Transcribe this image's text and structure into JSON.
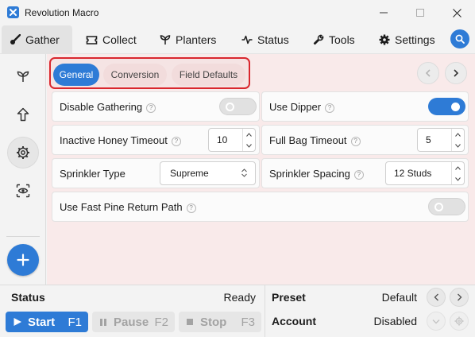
{
  "window": {
    "title": "Revolution Macro"
  },
  "tabs": [
    {
      "label": "Gather",
      "icon": "brush-icon"
    },
    {
      "label": "Collect",
      "icon": "ticket-icon"
    },
    {
      "label": "Planters",
      "icon": "sprout-icon"
    },
    {
      "label": "Status",
      "icon": "pulse-icon"
    },
    {
      "label": "Tools",
      "icon": "wrench-icon"
    },
    {
      "label": "Settings",
      "icon": "gear-icon"
    }
  ],
  "sidebar": [
    "sprout-icon",
    "upload-icon",
    "gear-icon",
    "eye-scan-icon",
    "plus-icon"
  ],
  "subtabs": [
    "General",
    "Conversion",
    "Field Defaults"
  ],
  "settings": {
    "disable_gathering": {
      "label": "Disable Gathering",
      "enabled": false
    },
    "use_dipper": {
      "label": "Use Dipper",
      "enabled": true
    },
    "inactive_honey_timeout": {
      "label": "Inactive Honey Timeout",
      "value": "10"
    },
    "full_bag_timeout": {
      "label": "Full Bag Timeout",
      "value": "5"
    },
    "sprinkler_type": {
      "label": "Sprinkler Type",
      "value": "Supreme"
    },
    "sprinkler_spacing": {
      "label": "Sprinkler Spacing",
      "value": "12 Studs"
    },
    "fast_pine": {
      "label": "Use Fast Pine Return Path",
      "enabled": false
    }
  },
  "help_glyph": "?",
  "bottom": {
    "status_label": "Status",
    "status_value": "Ready",
    "preset_label": "Preset",
    "preset_value": "Default",
    "account_label": "Account",
    "account_value": "Disabled",
    "start": {
      "label": "Start",
      "key": "F1"
    },
    "pause": {
      "label": "Pause",
      "key": "F2"
    },
    "stop": {
      "label": "Stop",
      "key": "F3"
    }
  },
  "colors": {
    "accent": "#2e7bd6",
    "highlight_border": "#d9272e",
    "content_bg": "#f9eaea"
  }
}
